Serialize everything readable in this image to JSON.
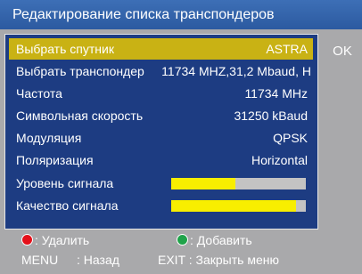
{
  "header": {
    "title": "Редактирование списка транспондеров"
  },
  "side": {
    "ok_label": "OK"
  },
  "rows": [
    {
      "label": "Выбрать спутник",
      "value": "ASTRA"
    },
    {
      "label": "Выбрать транспондер",
      "value": "11734 MHZ,31,2 Mbaud, H"
    },
    {
      "label": "Частота",
      "value": "11734 MHz"
    },
    {
      "label": "Символьная скорость",
      "value": "31250 kBaud"
    },
    {
      "label": "Модуляция",
      "value": "QPSK"
    },
    {
      "label": "Поляризация",
      "value": "Horizontal"
    }
  ],
  "signal": {
    "level_label": "Уровень сигнала",
    "level_fraction": 0.48,
    "quality_label": "Качество сигнала",
    "quality_fraction": 0.93
  },
  "footer": {
    "delete_label": ": Удалить",
    "add_label": ": Добавить",
    "menu_key": "MENU",
    "menu_action": ": Назад",
    "exit_label": "EXIT : Закрыть меню"
  },
  "colors": {
    "header_bg": "#2f5fa7",
    "panel_bg": "#1d3c82",
    "selected_row": "#c9b214",
    "bar_fill": "#f8ee00",
    "bar_track": "#c3c3c3",
    "page_bg": "#a9a9ab",
    "delete_dot": "#e4101a",
    "add_dot": "#20a34a"
  }
}
